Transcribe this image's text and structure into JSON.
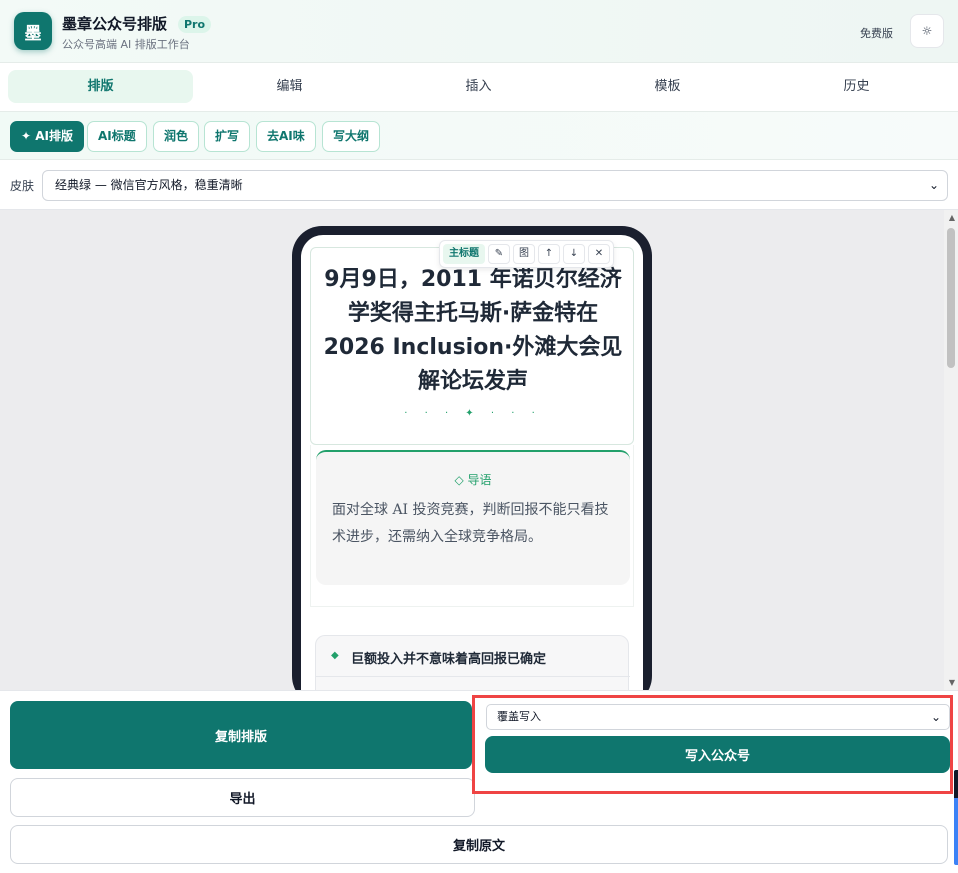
{
  "header": {
    "logo_text": "墨",
    "title": "墨章公众号排版",
    "badge": "Pro",
    "subtitle": "公众号高端 AI 排版工作台",
    "plan": "免费版",
    "settings_icon": "☼"
  },
  "tabs": [
    {
      "label": "排版",
      "active": true
    },
    {
      "label": "编辑",
      "active": false
    },
    {
      "label": "插入",
      "active": false
    },
    {
      "label": "模板",
      "active": false
    },
    {
      "label": "历史",
      "active": false
    }
  ],
  "ai_toolbar": {
    "buttons": [
      "✦ AI排版",
      "AI标题",
      "润色",
      "扩写",
      "去AI味",
      "写大纲"
    ]
  },
  "skin": {
    "label": "皮肤",
    "selected": "经典绿 — 微信官方风格，稳重清晰"
  },
  "preview": {
    "toolbar": {
      "tag": "主标题",
      "edit_icon": "✎",
      "image_label": "图",
      "up_icon": "↑",
      "down_icon": "↓",
      "close_icon": "✕"
    },
    "title": "9月9日，2011 年诺贝尔经济学奖得主托马斯·萨金特在 2026 Inclusion·外滩大会见解论坛发声",
    "decoration": "· · · ✦ · · ·",
    "lead": {
      "heading": "◇ 导语",
      "text": "面对全球 AI 投资竞赛，判断回报不能只看技术进步，还需纳入全球竞争格局。"
    },
    "section": {
      "icon": "◆",
      "title": "巨额投入并不意味着高回报已确定"
    }
  },
  "bottom": {
    "copy_layout": "复制排版",
    "export": "导出",
    "copy_source": "复制原文",
    "publish_mode": "覆盖写入",
    "publish": "写入公众号"
  },
  "colors": {
    "brand": "#0f766e",
    "accent": "#22a06b",
    "highlight_border": "#ef4444"
  }
}
